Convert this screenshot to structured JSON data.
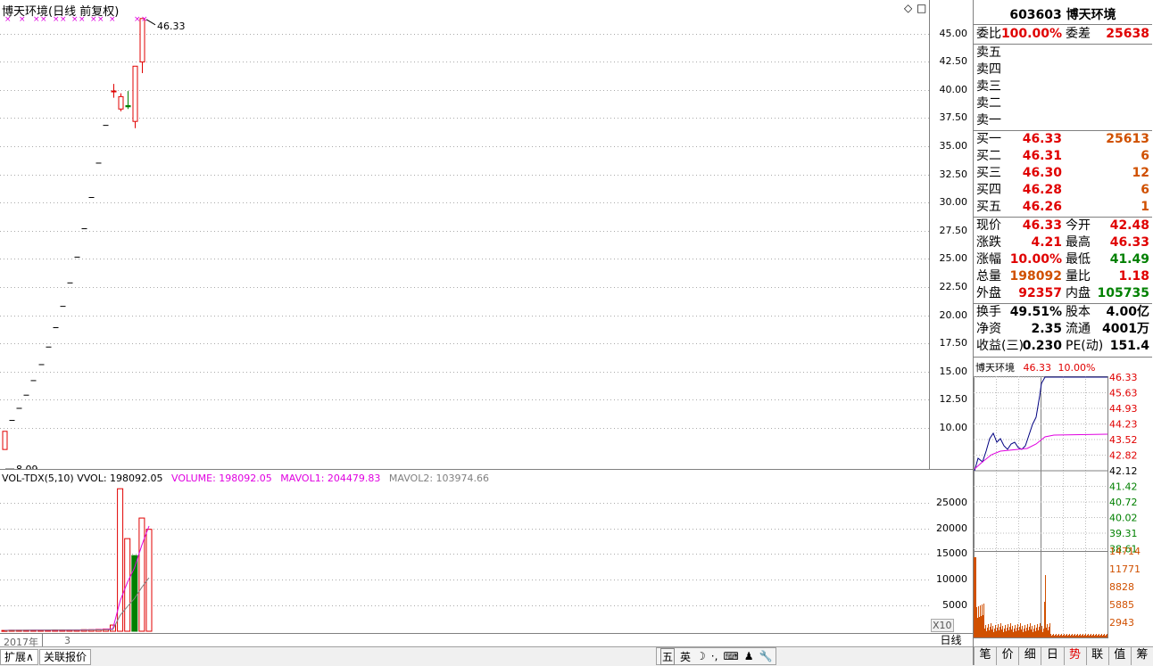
{
  "main_chart": {
    "title": "博天环境(日线 前复权)",
    "cross_marks": "×  ×  ××  ××  ××  ×        ×  ×  ××",
    "high_label": "46.33",
    "low_label": "8.09",
    "price_ticks": [
      "45.00",
      "42.50",
      "40.00",
      "37.50",
      "35.00",
      "32.50",
      "30.00",
      "27.50",
      "25.00",
      "22.50",
      "20.00",
      "17.50",
      "15.00",
      "12.50",
      "10.00"
    ],
    "diamond_icon": "◇",
    "square_icon": "□"
  },
  "volume_chart": {
    "indicator": "VOL-TDX(5,10)",
    "vvol": "VVOL: 198092.05",
    "volume": "VOLUME: 198092.05",
    "mavol1": "MAVOL1: 204479.83",
    "mavol2": "MAVOL2: 103974.66",
    "ticks": [
      "25000",
      "20000",
      "15000",
      "10000",
      "5000"
    ],
    "unit": "X10"
  },
  "date_axis": {
    "year": "2017年",
    "month": "3"
  },
  "period": "日线",
  "bottom_tabs": [
    "扩展∧",
    "关联报价"
  ],
  "ime_bar": [
    "五",
    "英",
    "☽",
    "·,",
    "⌨",
    "♟",
    "🔧"
  ],
  "quote": {
    "code_name": "603603 博天环境",
    "weibi_label": "委比",
    "weibi": "100.00%",
    "weicha_label": "委差",
    "weicha": "25638",
    "sell": [
      "卖五",
      "卖四",
      "卖三",
      "卖二",
      "卖一"
    ],
    "buy": [
      {
        "label": "买一",
        "price": "46.33",
        "vol": "25613"
      },
      {
        "label": "买二",
        "price": "46.31",
        "vol": "6"
      },
      {
        "label": "买三",
        "price": "46.30",
        "vol": "12"
      },
      {
        "label": "买四",
        "price": "46.28",
        "vol": "6"
      },
      {
        "label": "买五",
        "price": "46.26",
        "vol": "1"
      }
    ],
    "stats": [
      {
        "l1": "现价",
        "v1": "46.33",
        "l2": "今开",
        "v2": "42.48"
      },
      {
        "l1": "涨跌",
        "v1": "4.21",
        "l2": "最高",
        "v2": "46.33"
      },
      {
        "l1": "涨幅",
        "v1": "10.00%",
        "l2": "最低",
        "v2": "41.49"
      },
      {
        "l1": "总量",
        "v1": "198092",
        "l2": "量比",
        "v2": "1.18"
      },
      {
        "l1": "外盘",
        "v1": "92357",
        "l2": "内盘",
        "v2": "105735"
      }
    ],
    "fund": [
      {
        "l1": "换手",
        "v1": "49.51%",
        "l2": "股本",
        "v2": "4.00亿"
      },
      {
        "l1": "净资",
        "v1": "2.35",
        "l2": "流通",
        "v2": "4001万"
      },
      {
        "l1": "收益(三)",
        "v1": "0.230",
        "l2": "PE(动)",
        "v2": "151.4"
      }
    ]
  },
  "mini_chart": {
    "name": "博天环境",
    "price": "46.33",
    "change": "10.00%",
    "price_ticks": [
      "46.33",
      "45.63",
      "44.93",
      "44.23",
      "43.52",
      "42.82",
      "42.12",
      "41.42",
      "40.72",
      "40.02",
      "39.31",
      "38.61"
    ],
    "vol_ticks": [
      "14714",
      "11771",
      "8828",
      "5885",
      "2943"
    ]
  },
  "right_tabs": [
    "笔",
    "价",
    "细",
    "日",
    "势",
    "联",
    "值",
    "筹"
  ],
  "colors": {
    "up": "#e00000",
    "down": "#008000",
    "ma1": "#e000e0",
    "ma2": "#808080",
    "line": "#000080",
    "avg": "#e000e0"
  },
  "chart_data": [
    {
      "type": "candlestick",
      "title": "博天环境(日线 前复权)",
      "y_ticks": [
        10,
        12.5,
        15,
        17.5,
        20,
        22.5,
        25,
        27.5,
        30,
        32.5,
        35,
        37.5,
        40,
        42.5,
        45
      ],
      "annotations": [
        "46.33",
        "8.09"
      ],
      "candles": [
        {
          "o": 8.09,
          "h": 9.7,
          "l": 8.09,
          "c": 9.7
        },
        {
          "o": 10.67,
          "h": 10.67,
          "l": 10.67,
          "c": 10.67
        },
        {
          "o": 11.74,
          "h": 11.74,
          "l": 11.74,
          "c": 11.74
        },
        {
          "o": 12.91,
          "h": 12.91,
          "l": 12.91,
          "c": 12.91
        },
        {
          "o": 14.2,
          "h": 14.2,
          "l": 14.2,
          "c": 14.2
        },
        {
          "o": 15.62,
          "h": 15.62,
          "l": 15.62,
          "c": 15.62
        },
        {
          "o": 17.18,
          "h": 17.18,
          "l": 17.18,
          "c": 17.18
        },
        {
          "o": 18.9,
          "h": 18.9,
          "l": 18.9,
          "c": 18.9
        },
        {
          "o": 20.79,
          "h": 20.79,
          "l": 20.79,
          "c": 20.79
        },
        {
          "o": 22.87,
          "h": 22.87,
          "l": 22.87,
          "c": 22.87
        },
        {
          "o": 25.16,
          "h": 25.16,
          "l": 25.16,
          "c": 25.16
        },
        {
          "o": 27.68,
          "h": 27.68,
          "l": 27.68,
          "c": 27.68
        },
        {
          "o": 30.45,
          "h": 30.45,
          "l": 30.45,
          "c": 30.45
        },
        {
          "o": 33.5,
          "h": 33.5,
          "l": 33.5,
          "c": 33.5
        },
        {
          "o": 36.85,
          "h": 36.85,
          "l": 36.85,
          "c": 36.85
        },
        {
          "o": 39.9,
          "h": 40.53,
          "l": 39.3,
          "c": 39.9
        },
        {
          "o": 38.3,
          "h": 39.7,
          "l": 38.1,
          "c": 39.4
        },
        {
          "o": 38.6,
          "h": 39.9,
          "l": 38.3,
          "c": 38.5
        },
        {
          "o": 37.2,
          "h": 42.1,
          "l": 36.6,
          "c": 42.1
        },
        {
          "o": 42.48,
          "h": 46.33,
          "l": 41.49,
          "c": 46.33
        }
      ]
    },
    {
      "type": "bar",
      "title": "VOL-TDX(5,10)",
      "y_ticks": [
        5000,
        10000,
        15000,
        20000,
        25000
      ],
      "unit": "X10",
      "values": [
        150,
        200,
        200,
        200,
        200,
        200,
        200,
        250,
        250,
        250,
        250,
        300,
        300,
        350,
        400,
        1200,
        27700,
        18000,
        14700,
        22000,
        19809
      ],
      "colors": [
        "up",
        "up",
        "up",
        "up",
        "up",
        "up",
        "up",
        "up",
        "up",
        "up",
        "up",
        "up",
        "up",
        "up",
        "up",
        "up",
        "up",
        "up",
        "down",
        "up",
        "up"
      ],
      "ma1": [
        180,
        190,
        195,
        198,
        200,
        200,
        210,
        220,
        230,
        240,
        250,
        260,
        280,
        310,
        340,
        510,
        5890,
        9470,
        12380,
        16700,
        20448
      ],
      "ma2": [
        160,
        170,
        180,
        185,
        190,
        195,
        200,
        205,
        210,
        215,
        220,
        230,
        240,
        255,
        270,
        355,
        3080,
        4790,
        6380,
        8520,
        10397
      ]
    }
  ]
}
